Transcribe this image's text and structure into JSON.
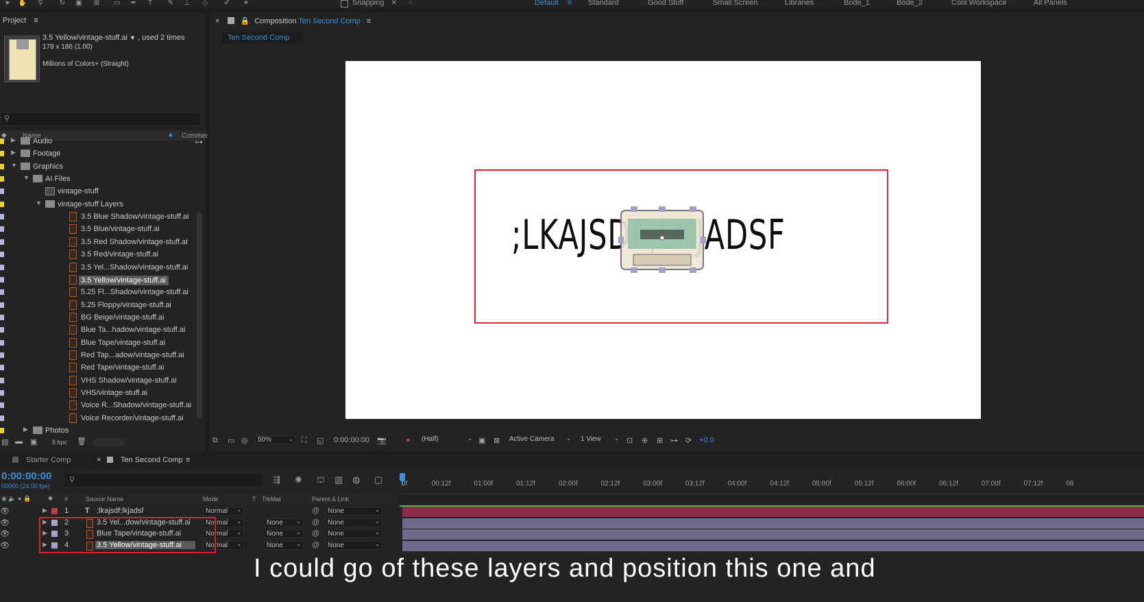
{
  "toolbar": {
    "snapping_label": "Snapping",
    "workspaces": [
      "Default",
      "Standard",
      "Good Stuff",
      "Small Screen",
      "Libraries",
      "Bode_1",
      "Bode_2",
      "Cool Workspace",
      "All Panels"
    ],
    "active_workspace": "Default"
  },
  "project": {
    "title": "Project",
    "item_name": "3.5 Yellow/vintage-stuff.ai",
    "used_count": ", used 2 times",
    "dimensions": "178 x 186 (1.00)",
    "colors": "Millions of Colors+ (Straight)",
    "col_name": "Name",
    "col_comment": "Commer",
    "tree": [
      {
        "label": "Audio",
        "type": "folder",
        "indent": 0,
        "tri": "▶",
        "swatch": "#e6d23c"
      },
      {
        "label": "Footage",
        "type": "folder",
        "indent": 0,
        "tri": "▶",
        "swatch": "#e6d23c"
      },
      {
        "label": "Graphics",
        "type": "folder",
        "indent": 0,
        "tri": "▼",
        "swatch": "#e6d23c"
      },
      {
        "label": "AI Files",
        "type": "folder",
        "indent": 1,
        "tri": "▼",
        "swatch": "#e6d23c"
      },
      {
        "label": "vintage-stuff",
        "type": "comp",
        "indent": 2,
        "tri": "",
        "swatch": "#b7b7d8"
      },
      {
        "label": "vintage-stuff Layers",
        "type": "folder",
        "indent": 2,
        "tri": "▼",
        "swatch": "#e6d23c"
      },
      {
        "label": "3.5 Blue Shadow/vintage-stuff.ai",
        "type": "ai",
        "indent": 3,
        "tri": "",
        "swatch": "#b7b7d8"
      },
      {
        "label": "3.5 Blue/vintage-stuff.ai",
        "type": "ai",
        "indent": 3,
        "tri": "",
        "swatch": "#b7b7d8"
      },
      {
        "label": "3.5 Red Shadow/vintage-stuff.ai",
        "type": "ai",
        "indent": 3,
        "tri": "",
        "swatch": "#b7b7d8"
      },
      {
        "label": "3.5 Red/vintage-stuff.ai",
        "type": "ai",
        "indent": 3,
        "tri": "",
        "swatch": "#b7b7d8"
      },
      {
        "label": "3.5 Yel...Shadow/vintage-stuff.ai",
        "type": "ai",
        "indent": 3,
        "tri": "",
        "swatch": "#b7b7d8"
      },
      {
        "label": "3.5 Yellow/vintage-stuff.ai",
        "type": "ai",
        "indent": 3,
        "tri": "",
        "swatch": "#b7b7d8",
        "selected": true
      },
      {
        "label": "5.25 Fl...Shadow/vintage-stuff.ai",
        "type": "ai",
        "indent": 3,
        "tri": "",
        "swatch": "#b7b7d8"
      },
      {
        "label": "5.25 Floppy/vintage-stuff.ai",
        "type": "ai",
        "indent": 3,
        "tri": "",
        "swatch": "#b7b7d8"
      },
      {
        "label": "BG Beige/vintage-stuff.ai",
        "type": "ai",
        "indent": 3,
        "tri": "",
        "swatch": "#b7b7d8"
      },
      {
        "label": "Blue Ta...hadow/vintage-stuff.ai",
        "type": "ai",
        "indent": 3,
        "tri": "",
        "swatch": "#b7b7d8"
      },
      {
        "label": "Blue Tape/vintage-stuff.ai",
        "type": "ai",
        "indent": 3,
        "tri": "",
        "swatch": "#b7b7d8"
      },
      {
        "label": "Red Tap...adow/vintage-stuff.ai",
        "type": "ai",
        "indent": 3,
        "tri": "",
        "swatch": "#b7b7d8"
      },
      {
        "label": "Red Tape/vintage-stuff.ai",
        "type": "ai",
        "indent": 3,
        "tri": "",
        "swatch": "#b7b7d8"
      },
      {
        "label": "VHS Shadow/vintage-stuff.ai",
        "type": "ai",
        "indent": 3,
        "tri": "",
        "swatch": "#b7b7d8"
      },
      {
        "label": "VHS/vintage-stuff.ai",
        "type": "ai",
        "indent": 3,
        "tri": "",
        "swatch": "#b7b7d8"
      },
      {
        "label": "Voice R...Shadow/vintage-stuff.ai",
        "type": "ai",
        "indent": 3,
        "tri": "",
        "swatch": "#b7b7d8"
      },
      {
        "label": "Voice Recorder/vintage-stuff.ai",
        "type": "ai",
        "indent": 3,
        "tri": "",
        "swatch": "#b7b7d8"
      },
      {
        "label": "Photos",
        "type": "folder",
        "indent": 1,
        "tri": "▶",
        "swatch": "#e6d23c"
      }
    ],
    "bpc": "8 bpc"
  },
  "composition": {
    "panel_label": "Composition",
    "comp_name": "Ten Second Comp",
    "subtab": "Ten Second Comp",
    "canvas_text": ";LKAJSDF;LKJADSF",
    "zoom": "50%",
    "time": "0:00:00:00",
    "resolution": "(Half)",
    "camera": "Active Camera",
    "views": "1 View",
    "exposure": "+0.0"
  },
  "timeline": {
    "tabs": [
      "Starter Comp",
      "Ten Second Comp"
    ],
    "timecode": "0:00:00:00",
    "fps": "00000 (24.00 fps)",
    "headers": {
      "source": "Source Name",
      "mode": "Mode",
      "t": "T",
      "trkmat": "TrkMat",
      "parent": "Parent & Link",
      "num": "#"
    },
    "ruler": [
      "0f",
      "00:12f",
      "01:00f",
      "01:12f",
      "02:00f",
      "02:12f",
      "03:00f",
      "03:12f",
      "04:00f",
      "04:12f",
      "05:00f",
      "05:12f",
      "06:00f",
      "06:12f",
      "07:00f",
      "07:12f",
      "08"
    ],
    "layers": [
      {
        "num": "1",
        "name": ";lkajsdf;lkjadsf",
        "type": "text",
        "mode": "Normal",
        "trkmat": "",
        "parent": "None",
        "label_color": "#c23b4d",
        "bar_color": "#8e2b48"
      },
      {
        "num": "2",
        "name": "3.5 Yel...dow/vintage-stuff.ai",
        "type": "ai",
        "mode": "Normal",
        "trkmat": "None",
        "parent": "None",
        "label_color": "#a8a4c6",
        "bar_color": "#6e6a8a"
      },
      {
        "num": "3",
        "name": "Blue Tape/vintage-stuff.ai",
        "type": "ai",
        "mode": "Normal",
        "trkmat": "None",
        "parent": "None",
        "label_color": "#a8a4c6",
        "bar_color": "#6e6a8a"
      },
      {
        "num": "4",
        "name": "3.5 Yellow/vintage-stuff.ai",
        "type": "ai",
        "mode": "Normal",
        "trkmat": "None",
        "parent": "None",
        "label_color": "#a8a4c6",
        "bar_color": "#6e6a8a",
        "selected": true
      }
    ]
  },
  "caption": "I could go of these layers and position this one and",
  "colors": {
    "accent": "#3d8fd6",
    "highlight_red": "#d9252d",
    "canvas": "#ffffff"
  }
}
